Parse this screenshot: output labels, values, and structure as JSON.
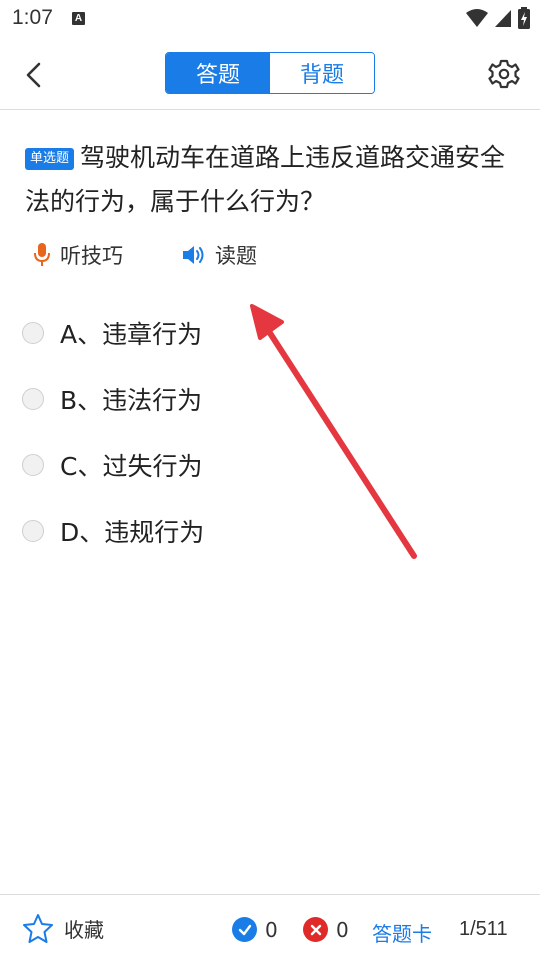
{
  "status_bar": {
    "time": "1:07",
    "notification_icon": "A",
    "icons": [
      "wifi-icon",
      "signal-icon",
      "battery-charging-icon"
    ]
  },
  "header": {
    "back_icon": "chevron-left-icon",
    "tabs": [
      {
        "label": "答题",
        "active": true
      },
      {
        "label": "背题",
        "active": false
      }
    ],
    "settings_icon": "gear-icon"
  },
  "question": {
    "type_badge": "单选题",
    "text": "驾驶机动车在道路上违反道路交通安全法的行为，属于什么行为？"
  },
  "tools": [
    {
      "label": "听技巧",
      "icon": "microphone-icon",
      "color": "#e8651c"
    },
    {
      "label": "读题",
      "icon": "speaker-icon",
      "color": "#1a7ce6"
    }
  ],
  "options": [
    {
      "label": "A、违章行为"
    },
    {
      "label": "B、违法行为"
    },
    {
      "label": "C、过失行为"
    },
    {
      "label": "D、违规行为"
    }
  ],
  "bottom_bar": {
    "favorite_label": "收藏",
    "correct_count": "0",
    "wrong_count": "0",
    "answer_card_label": "答题卡",
    "page": "1/511"
  },
  "colors": {
    "accent": "#1a7ce6",
    "wrong": "#e02a2a",
    "arrow": "#e5373f"
  }
}
